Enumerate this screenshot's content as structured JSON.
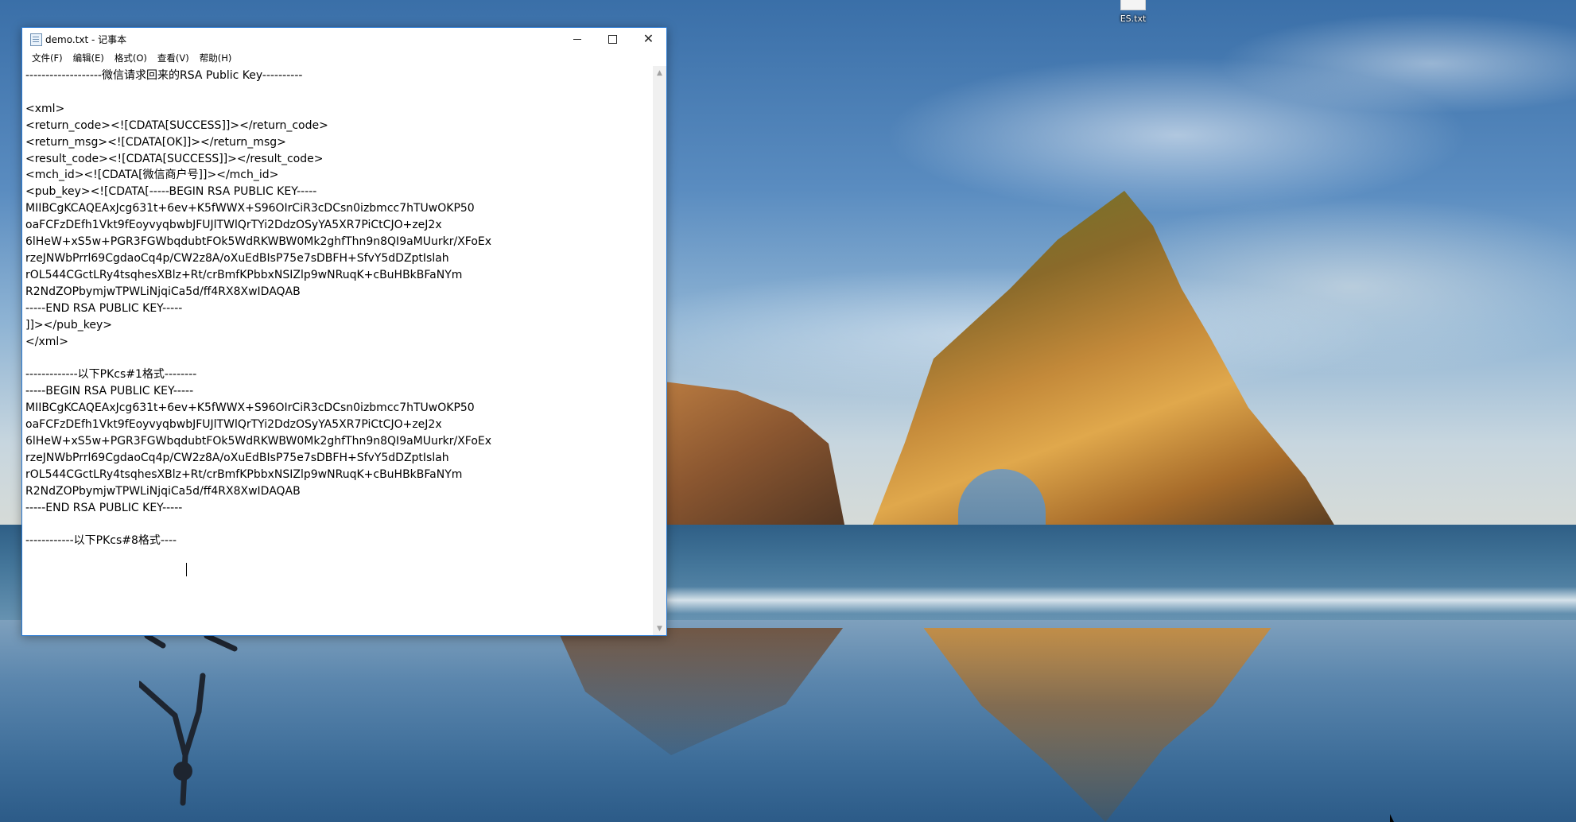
{
  "desktop": {
    "icon_label": "ES.txt"
  },
  "window": {
    "title": "demo.txt - 记事本",
    "controls": {
      "minimize_icon": "minimize-icon",
      "maximize_icon": "maximize-icon",
      "close_icon": "close-icon"
    },
    "menu": [
      "文件(F)",
      "编辑(E)",
      "格式(O)",
      "查看(V)",
      "帮助(H)"
    ]
  },
  "editor": {
    "lines": [
      "-------------------微信请求回来的RSA Public Key----------",
      "",
      "<xml>",
      "<return_code><![CDATA[SUCCESS]]></return_code>",
      "<return_msg><![CDATA[OK]]></return_msg>",
      "<result_code><![CDATA[SUCCESS]]></result_code>",
      "<mch_id><![CDATA[微信商户号]]></mch_id>",
      "<pub_key><![CDATA[-----BEGIN RSA PUBLIC KEY-----",
      "MIIBCgKCAQEAxJcg631t+6ev+K5fWWX+S96OIrCiR3cDCsn0izbmcc7hTUwOKP50",
      "oaFCFzDEfh1Vkt9fEoyvyqbwbJFUJlTWlQrTYi2DdzOSyYA5XR7PiCtCJO+zeJ2x",
      "6lHeW+xS5w+PGR3FGWbqdubtFOk5WdRKWBW0Mk2ghfThn9n8QI9aMUurkr/XFoEx",
      "rzeJNWbPrrl69CgdaoCq4p/CW2z8A/oXuEdBIsP75e7sDBFH+SfvY5dDZptIslah",
      "rOL544CGctLRy4tsqhesXBlz+Rt/crBmfKPbbxNSIZlp9wNRuqK+cBuHBkBFaNYm",
      "R2NdZOPbymjwTPWLiNjqiCa5d/ff4RX8XwIDAQAB",
      "-----END RSA PUBLIC KEY-----",
      "]]></pub_key>",
      "</xml>",
      "",
      "-------------以下PKcs#1格式--------",
      "-----BEGIN RSA PUBLIC KEY-----",
      "MIIBCgKCAQEAxJcg631t+6ev+K5fWWX+S96OIrCiR3cDCsn0izbmcc7hTUwOKP50",
      "oaFCFzDEfh1Vkt9fEoyvyqbwbJFUJlTWlQrTYi2DdzOSyYA5XR7PiCtCJO+zeJ2x",
      "6lHeW+xS5w+PGR3FGWbqdubtFOk5WdRKWBW0Mk2ghfThn9n8QI9aMUurkr/XFoEx",
      "rzeJNWbPrrl69CgdaoCq4p/CW2z8A/oXuEdBIsP75e7sDBFH+SfvY5dDZptIslah",
      "rOL544CGctLRy4tsqhesXBlz+Rt/crBmfKPbbxNSIZlp9wNRuqK+cBuHBkBFaNYm",
      "R2NdZOPbymjwTPWLiNjqiCa5d/ff4RX8XwIDAQAB",
      "-----END RSA PUBLIC KEY-----",
      "",
      "------------以下PKcs#8格式----"
    ]
  },
  "scrollbar": {
    "up_icon": "chevron-up-icon",
    "down_icon": "chevron-down-icon"
  }
}
